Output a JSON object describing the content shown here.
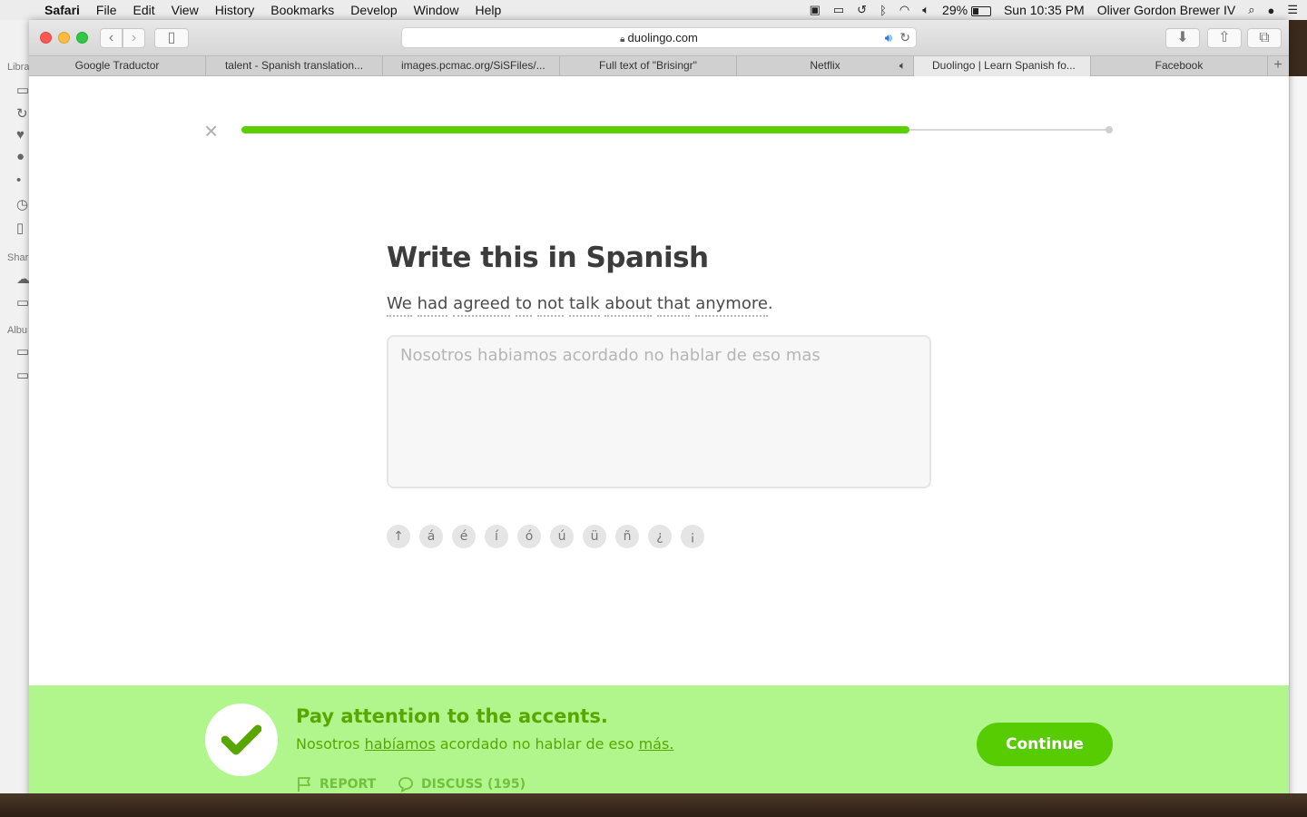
{
  "menubar": {
    "app": "Safari",
    "items": [
      "File",
      "Edit",
      "View",
      "History",
      "Bookmarks",
      "Develop",
      "Window",
      "Help"
    ],
    "battery": "29%",
    "clock": "Sun 10:35 PM",
    "user": "Oliver Gordon Brewer IV"
  },
  "background_app": {
    "labels": [
      "Libra",
      "Shar",
      "Albu"
    ]
  },
  "browser": {
    "url": "duolingo.com",
    "tabs": [
      {
        "title": "Google Traductor"
      },
      {
        "title": "talent - Spanish translation..."
      },
      {
        "title": "images.pcmac.org/SiSFiles/..."
      },
      {
        "title": "Full text of \"Brisingr\""
      },
      {
        "title": "Netflix"
      },
      {
        "title": "Duolingo | Learn Spanish fo..."
      },
      {
        "title": "Facebook"
      }
    ],
    "new_tab_symbol": "+"
  },
  "lesson": {
    "progress": 0.77,
    "prompt_title": "Write this in Spanish",
    "sentence_words": [
      "We",
      "had",
      "agreed",
      "to",
      "not",
      "talk",
      "about",
      "that",
      "anymore"
    ],
    "sentence_end": ".",
    "answer_text": "Nosotros habiamos acordado no hablar de eso mas",
    "special_chars": [
      "↑",
      "á",
      "é",
      "í",
      "ó",
      "ú",
      "ü",
      "ñ",
      "¿",
      "¡"
    ]
  },
  "feedback": {
    "title": "Pay attention to the accents.",
    "answer_parts": [
      {
        "text": "Nosotros ",
        "underline": false
      },
      {
        "text": "habíamos",
        "underline": true
      },
      {
        "text": " acordado no hablar de eso ",
        "underline": false
      },
      {
        "text": "más.",
        "underline": true
      }
    ],
    "report_label": "REPORT",
    "discuss_label": "DISCUSS (195)",
    "continue_label": "Continue"
  },
  "colors": {
    "progress": "#5bd000",
    "footer_bg": "#b0f68c",
    "footer_text": "#58a700",
    "continue_bg": "#58cc02"
  }
}
